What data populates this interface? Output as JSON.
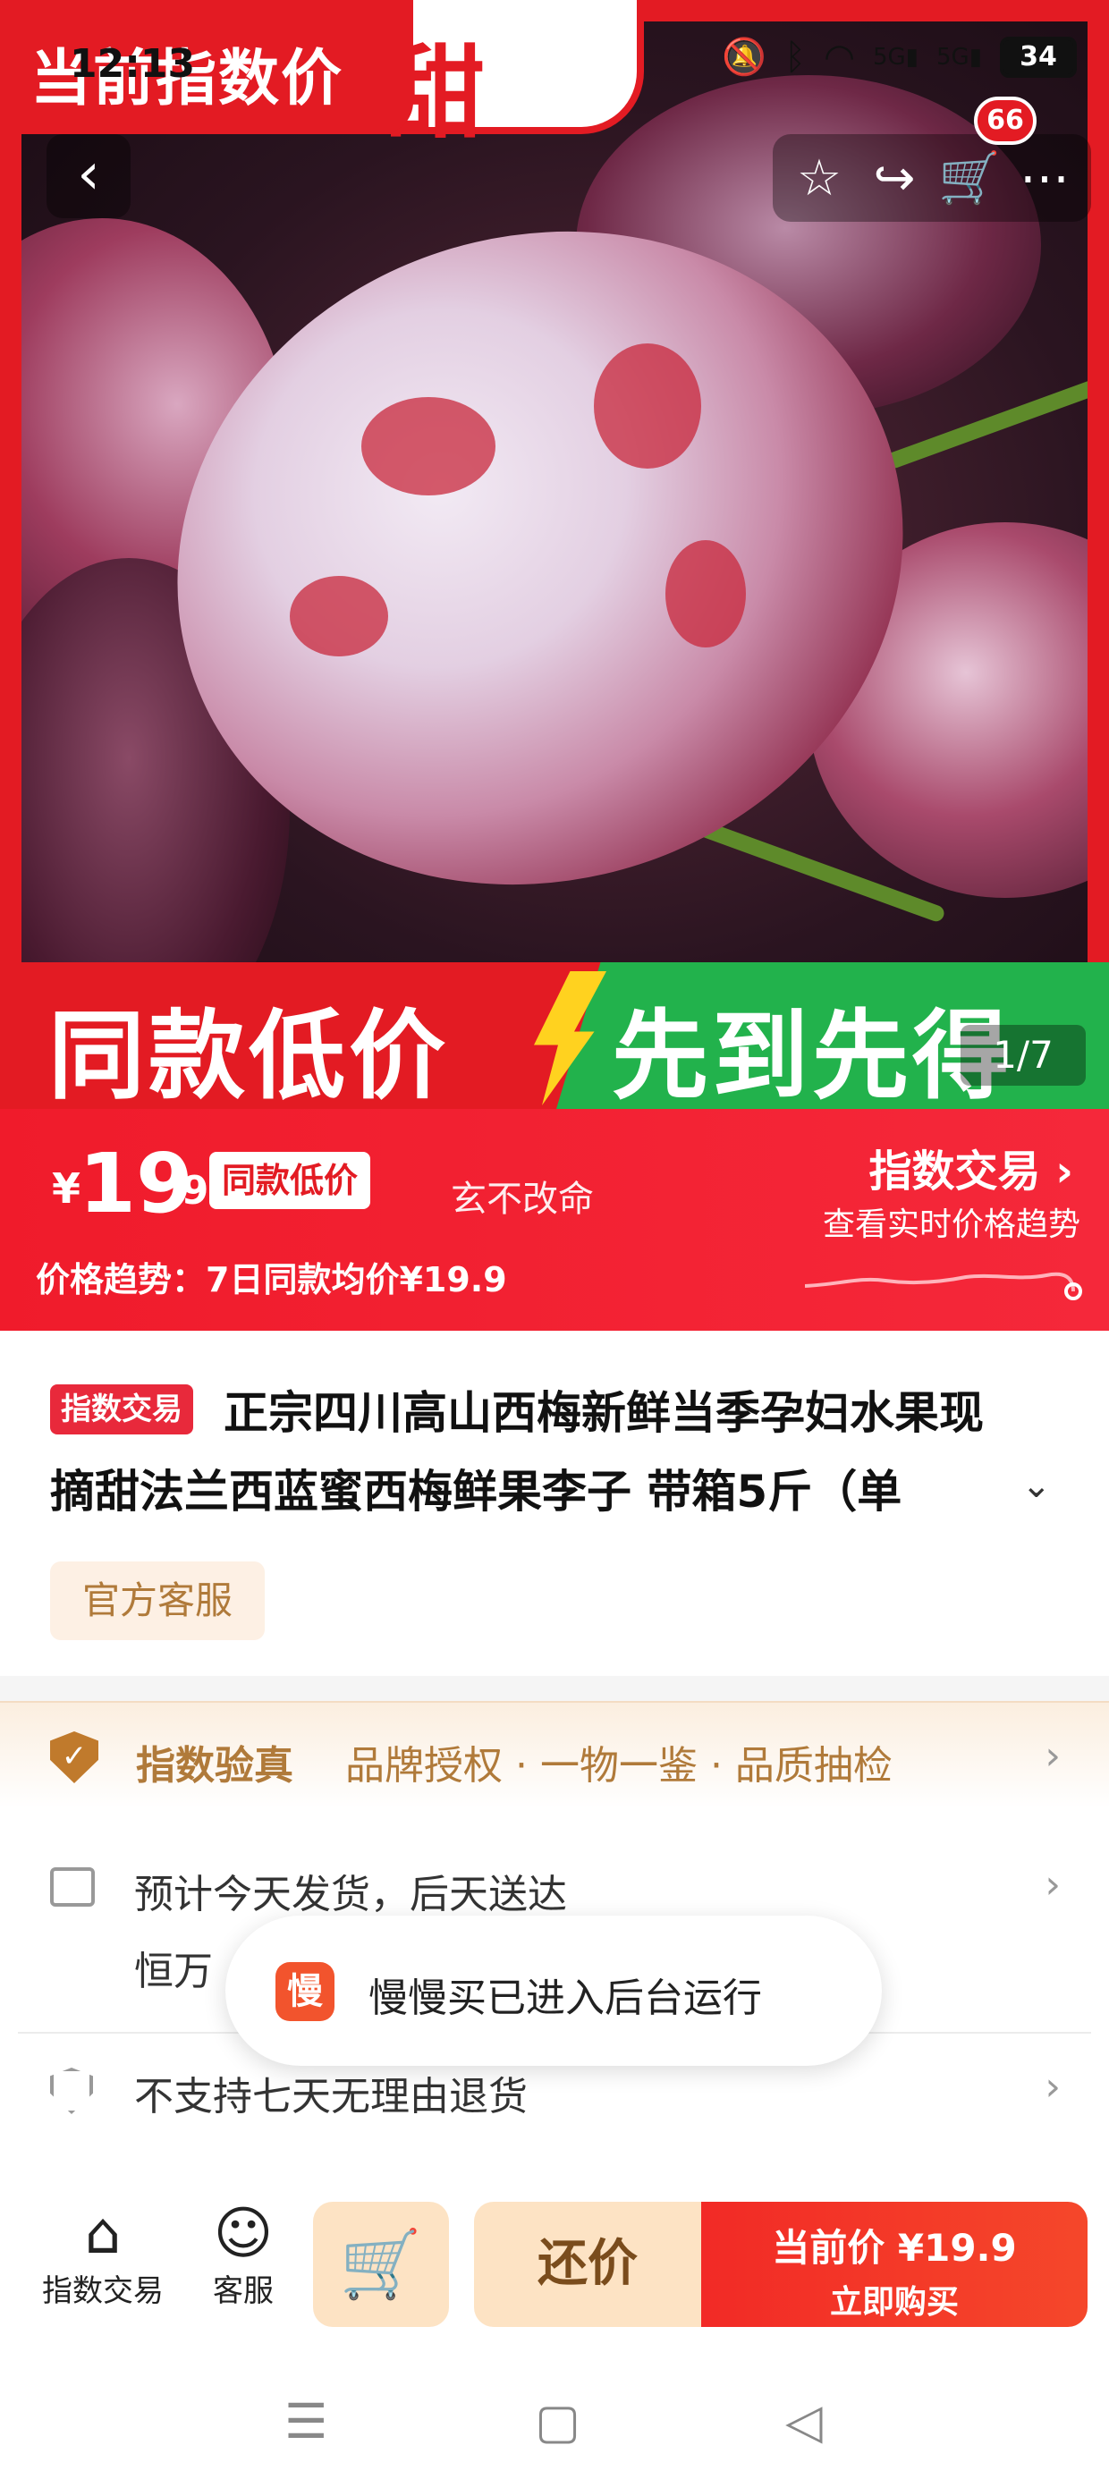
{
  "status_bar": {
    "time": "12:13",
    "network_1": "5G",
    "network_2": "5G",
    "battery": "34"
  },
  "hero": {
    "price_tag": "当前指数价",
    "sweet_banner": "甜",
    "promo_left": "同款低价",
    "promo_right": "先到先得",
    "image_counter": "1/7",
    "cart_badge": "66"
  },
  "price_bar": {
    "currency": "¥",
    "price_int": "19",
    "price_dec": ".9",
    "badge": "同款低价",
    "watermark": "玄不改命",
    "index_trade": "指数交易",
    "view_trend": "查看实时价格趋势",
    "trend_line": "价格趋势：7日同款均价¥19.9"
  },
  "product": {
    "tag": "指数交易",
    "title_line1": "正宗四川高山西梅新鲜当季孕妇水果现",
    "title_line2": "摘甜法兰西蓝蜜西梅鲜果李子 带箱5斤（单",
    "official_cs": "官方客服"
  },
  "services": {
    "verify_title": "指数验真",
    "verify_desc": "品牌授权 · 一物一鉴 · 品质抽检",
    "ship_line1": "预计今天发货，后天送达",
    "ship_line2": "恒万 ·",
    "returns": "不支持七天无理由退货"
  },
  "toast": {
    "icon_char": "慢",
    "text": "慢慢买已进入后台运行"
  },
  "bottom_bar": {
    "index_trade": "指数交易",
    "service": "客服",
    "haggle": "还价",
    "buy_price": "当前价 ¥19.9",
    "buy_now": "立即购买"
  },
  "colors": {
    "accent_red": "#e31b23",
    "promo_green": "#22b24c",
    "gold": "#b07a3a"
  }
}
